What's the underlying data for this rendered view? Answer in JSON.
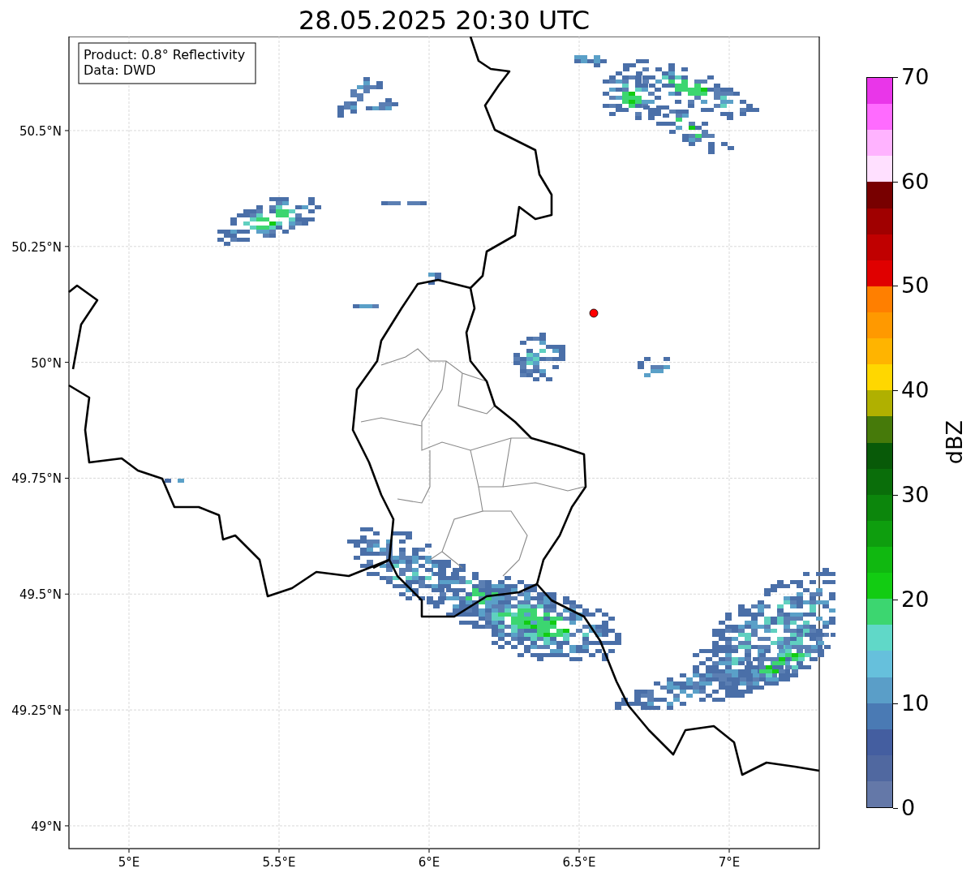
{
  "title": "28.05.2025 20:30 UTC",
  "map": {
    "legend": [
      "Product: 0.8° Reflectivity",
      "Data: DWD"
    ],
    "lon_ticks": [
      "5°E",
      "5.5°E",
      "6°E",
      "6.5°E",
      "7°E"
    ],
    "lat_ticks": [
      "50.5°N",
      "50.25°N",
      "50°N",
      "49.75°N",
      "49.5°N",
      "49.25°N",
      "49°N"
    ]
  },
  "colorbar": {
    "label": "dBZ",
    "ticks": [
      "70",
      "60",
      "50",
      "40",
      "30",
      "20",
      "10",
      "0"
    ],
    "bands": [
      {
        "color": "#e936e9"
      },
      {
        "color": "#ff6bff"
      },
      {
        "color": "#ffb3ff"
      },
      {
        "color": "#ffe0ff"
      },
      {
        "color": "#780000"
      },
      {
        "color": "#a00000"
      },
      {
        "color": "#c00000"
      },
      {
        "color": "#e00000"
      },
      {
        "color": "#ff7f00"
      },
      {
        "color": "#ff9900"
      },
      {
        "color": "#ffb400"
      },
      {
        "color": "#ffd700"
      },
      {
        "color": "#b0b000"
      },
      {
        "color": "#467a0a"
      },
      {
        "color": "#085a08"
      },
      {
        "color": "#0a6e0a"
      },
      {
        "color": "#0c860c"
      },
      {
        "color": "#0e9e0e"
      },
      {
        "color": "#10b810"
      },
      {
        "color": "#12cc12"
      },
      {
        "color": "#3cd670"
      },
      {
        "color": "#60d8c8"
      },
      {
        "color": "#66c0dc"
      },
      {
        "color": "#5a9ec8"
      },
      {
        "color": "#4a7ab4"
      },
      {
        "color": "#445ea0"
      },
      {
        "color": "#5068a0"
      },
      {
        "color": "#6478a8"
      }
    ]
  }
}
